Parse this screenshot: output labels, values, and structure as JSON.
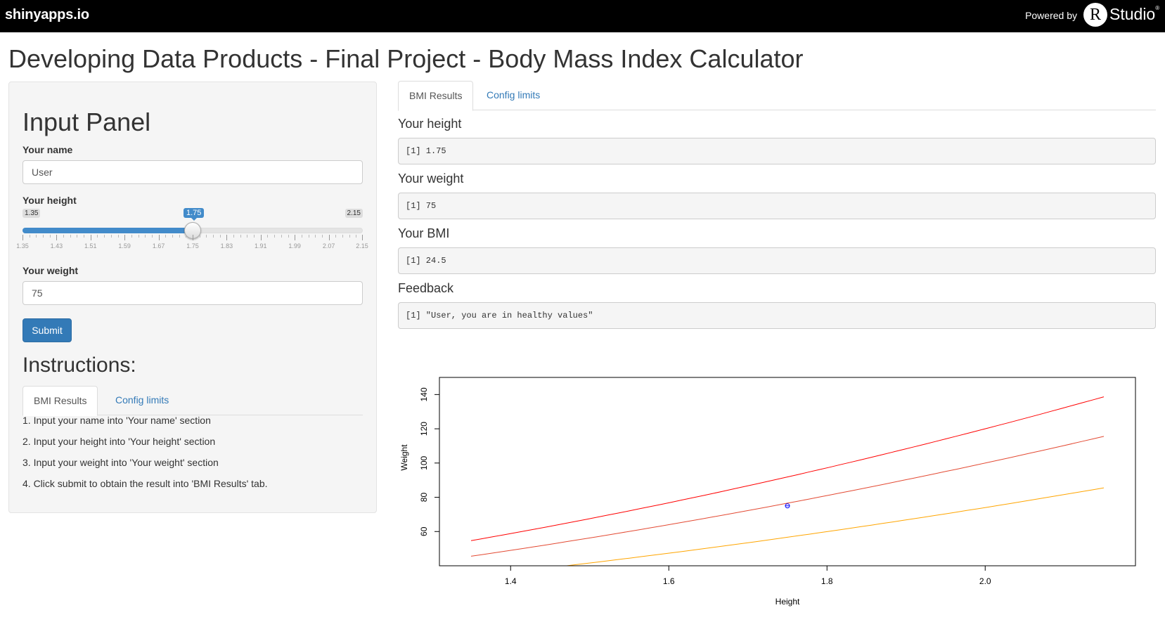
{
  "topbar": {
    "brand": "shinyapps.io",
    "powered_by": "Powered by",
    "rstudio_logo": "R",
    "rstudio_word": "Studio",
    "rstudio_reg": "®"
  },
  "page_title": "Developing Data Products - Final Project - Body Mass Index Calculator",
  "sidebar": {
    "title": "Input Panel",
    "name_label": "Your name",
    "name_value": "User",
    "height_label": "Your height",
    "height_slider": {
      "min_label": "1.35",
      "max_label": "2.15",
      "value_label": "1.75",
      "min": 1.35,
      "max": 2.15,
      "value": 1.75,
      "tick_labels": [
        "1.35",
        "1.43",
        "1.51",
        "1.59",
        "1.67",
        "1.75",
        "1.83",
        "1.91",
        "1.99",
        "2.07",
        "2.15"
      ]
    },
    "weight_label": "Your weight",
    "weight_value": "75",
    "submit_label": "Submit",
    "instructions_title": "Instructions:",
    "tabs": [
      {
        "label": "BMI Results",
        "active": true
      },
      {
        "label": "Config limits",
        "active": false
      }
    ],
    "instructions": [
      "1. Input your name into 'Your name' section",
      "2. Input your height into 'Your height' section",
      "3. Input your weight into 'Your weight' section",
      "4. Click submit to obtain the result into 'BMI Results' tab."
    ]
  },
  "main": {
    "tabs": [
      {
        "label": "BMI Results",
        "active": true
      },
      {
        "label": "Config limits",
        "active": false
      }
    ],
    "outputs": [
      {
        "label": "Your height",
        "value": "[1] 1.75"
      },
      {
        "label": "Your weight",
        "value": "[1] 75"
      },
      {
        "label": "Your BMI",
        "value": "[1] 24.5"
      },
      {
        "label": "Feedback",
        "value": "[1] \"User, you are in healthy values\""
      }
    ]
  },
  "chart_data": {
    "type": "line",
    "xlabel": "Height",
    "ylabel": "Weight",
    "xlim": [
      1.31,
      2.19
    ],
    "ylim": [
      40,
      150
    ],
    "x_ticks": [
      1.4,
      1.6,
      1.8,
      2.0
    ],
    "y_ticks": [
      60,
      80,
      100,
      120,
      140
    ],
    "x_tick_labels": [
      "1.4",
      "1.6",
      "1.8",
      "2.0"
    ],
    "y_tick_labels": [
      "60",
      "80",
      "100",
      "120",
      "140"
    ],
    "grid": false,
    "series": [
      {
        "bmi": 30,
        "color": "#ff0000",
        "x": [
          1.35,
          2.15
        ],
        "y": [
          54.7,
          138.7
        ]
      },
      {
        "bmi": 25,
        "color": "#e34a33",
        "x": [
          1.35,
          2.15
        ],
        "y": [
          45.6,
          115.6
        ]
      },
      {
        "bmi": 18.5,
        "color": "#ffa500",
        "x": [
          1.35,
          2.15
        ],
        "y": [
          33.7,
          85.5
        ]
      }
    ],
    "point": {
      "x": 1.75,
      "y": 75,
      "color": "#0000ff"
    }
  }
}
